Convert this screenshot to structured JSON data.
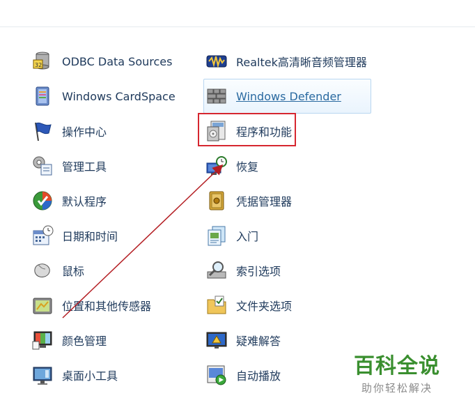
{
  "left_items": [
    {
      "label": "ODBC Data Sources",
      "icon": "database-icon"
    },
    {
      "label": "Windows CardSpace",
      "icon": "cardspace-icon"
    },
    {
      "label": "操作中心",
      "icon": "flag-icon"
    },
    {
      "label": "管理工具",
      "icon": "admin-tools-icon"
    },
    {
      "label": "默认程序",
      "icon": "default-programs-icon"
    },
    {
      "label": "日期和时间",
      "icon": "calendar-clock-icon"
    },
    {
      "label": "鼠标",
      "icon": "mouse-icon"
    },
    {
      "label": "位置和其他传感器",
      "icon": "sensor-icon"
    },
    {
      "label": "颜色管理",
      "icon": "color-management-icon"
    },
    {
      "label": "桌面小工具",
      "icon": "gadgets-icon"
    }
  ],
  "right_items": [
    {
      "label": "Realtek高清晰音频管理器",
      "icon": "audio-icon"
    },
    {
      "label": "Windows Defender",
      "icon": "defender-wall-icon"
    },
    {
      "label": "程序和功能",
      "icon": "programs-features-icon"
    },
    {
      "label": "恢复",
      "icon": "recovery-icon"
    },
    {
      "label": "凭据管理器",
      "icon": "credential-vault-icon"
    },
    {
      "label": "入门",
      "icon": "getting-started-icon"
    },
    {
      "label": "索引选项",
      "icon": "indexing-icon"
    },
    {
      "label": "文件夹选项",
      "icon": "folder-options-icon"
    },
    {
      "label": "疑难解答",
      "icon": "troubleshoot-icon"
    },
    {
      "label": "自动播放",
      "icon": "autoplay-icon"
    }
  ],
  "hover_item": "Windows Defender",
  "highlighted_item": "程序和功能",
  "watermark": {
    "title": "百科全说",
    "subtitle": "助你轻松解决"
  },
  "colors": {
    "link_text": "#1e395b",
    "highlight_box": "#d6262f",
    "arrow": "#b41e23",
    "watermark": "#3a8f2f"
  }
}
